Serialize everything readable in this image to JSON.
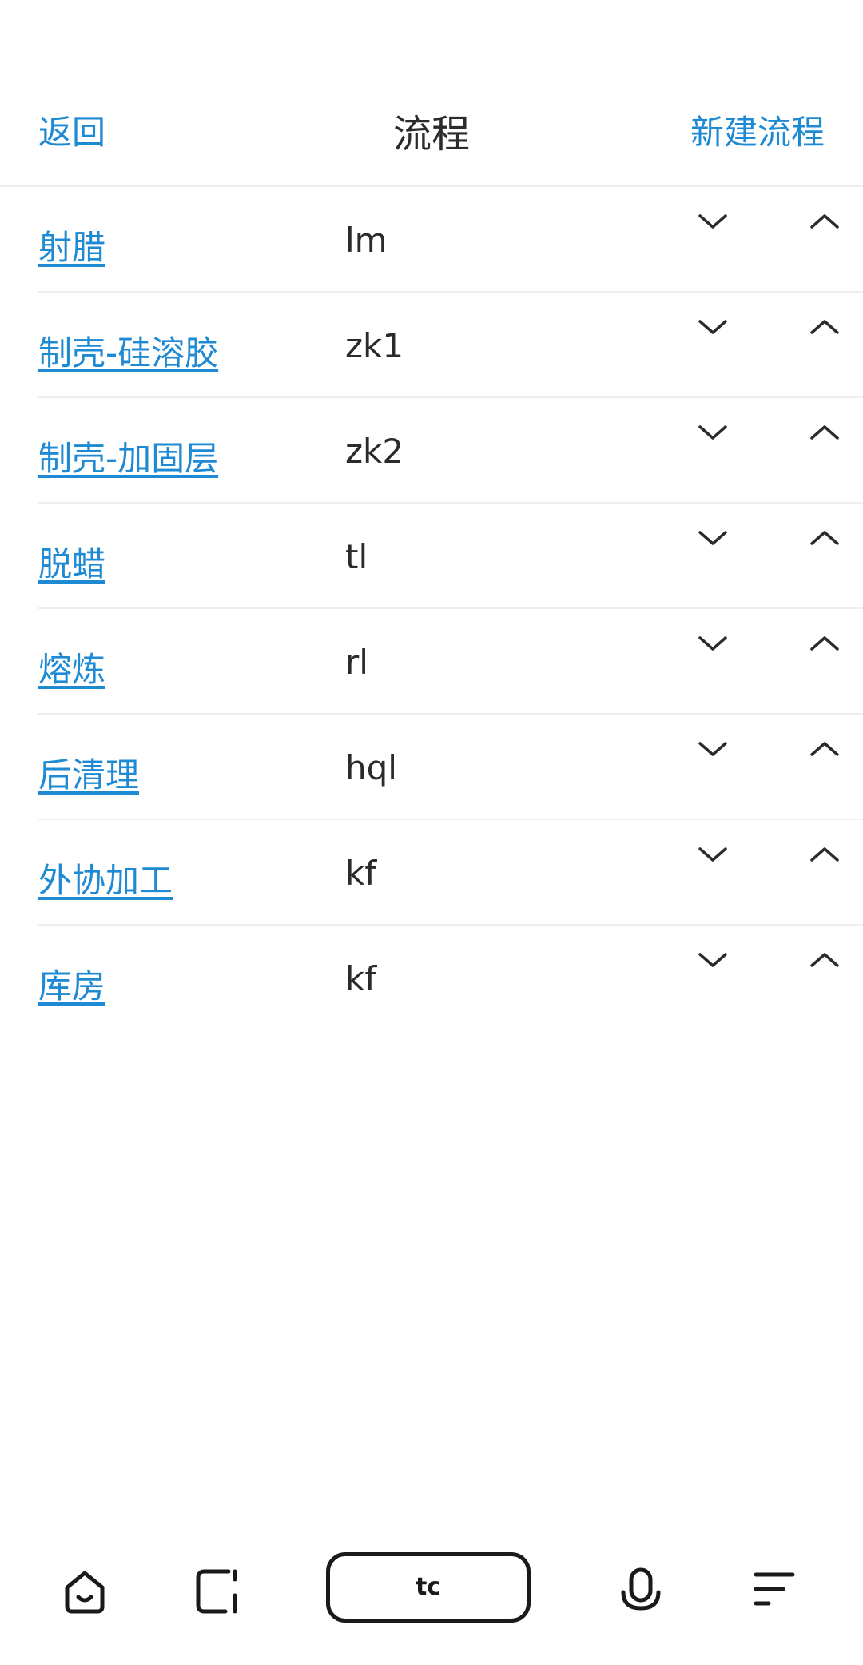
{
  "header": {
    "back_label": "返回",
    "title": "流程",
    "new_label": "新建流程"
  },
  "processes": [
    {
      "name": "射腊",
      "code": "lm"
    },
    {
      "name": "制壳-硅溶胶",
      "code": "zk1"
    },
    {
      "name": "制壳-加固层",
      "code": "zk2"
    },
    {
      "name": "脱蜡",
      "code": "tl"
    },
    {
      "name": "熔炼",
      "code": "rl"
    },
    {
      "name": "后清理",
      "code": "hql"
    },
    {
      "name": "外协加工",
      "code": "kf"
    },
    {
      "name": "库房",
      "code": "kf"
    }
  ],
  "bottom_nav": {
    "home_icon": "home-icon",
    "tabs_icon": "tabs-icon",
    "center_label": "tc",
    "voice_icon": "microphone-icon",
    "menu_icon": "menu-icon"
  },
  "colors": {
    "link": "#1f8ad4",
    "text": "#2b2b2b",
    "divider": "#eeeeee"
  }
}
